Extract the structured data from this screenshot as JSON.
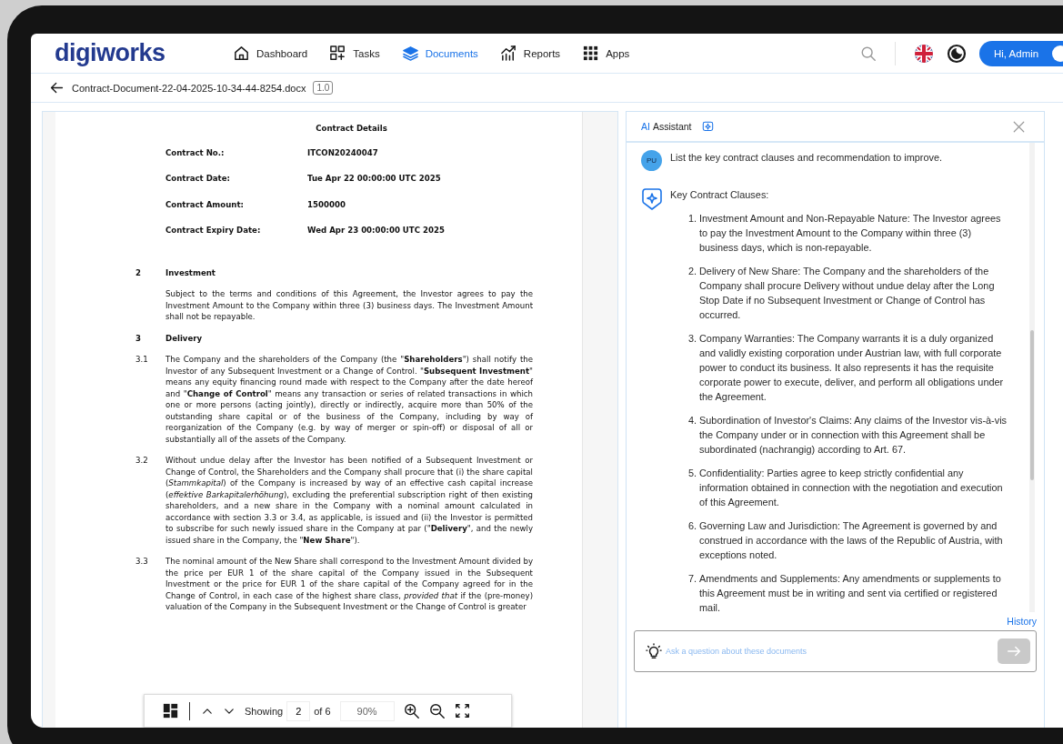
{
  "nav": {
    "logo": "digiworks",
    "items": [
      {
        "label": "Dashboard",
        "selected": false
      },
      {
        "label": "Tasks",
        "selected": false
      },
      {
        "label": "Documents",
        "selected": true
      },
      {
        "label": "Reports",
        "selected": false
      },
      {
        "label": "Apps",
        "selected": false
      }
    ],
    "user_button": "Hi, Admin"
  },
  "document_header": {
    "filename": "Contract-Document-22-04-2025-10-34-44-8254.docx",
    "version": "1.0"
  },
  "document": {
    "title": "Contract Details",
    "details": [
      {
        "label": "Contract No.:",
        "value": "ITCON20240047"
      },
      {
        "label": "Contract Date:",
        "value": "Tue Apr 22 00:00:00 UTC 2025"
      },
      {
        "label": "Contract Amount:",
        "value": "1500000"
      },
      {
        "label": "Contract Expiry Date:",
        "value": "Wed Apr 23 00:00:00 UTC 2025"
      }
    ],
    "blocks": [
      {
        "kind": "heading",
        "number": "2",
        "text": "Investment"
      },
      {
        "kind": "paragraph",
        "text": "Subject to the terms and conditions of this Agreement, the Investor agrees to pay the Investment Amount to the Company within three (3) business days. The Investment Amount shall not be repayable."
      },
      {
        "kind": "heading",
        "number": "3",
        "text": "Delivery"
      },
      {
        "kind": "paragraph",
        "number": "3.1",
        "text": "The Company and the shareholders of the Company (the \"**Shareholders**\") shall notify the Investor of any Subsequent Investment or a Change of Control. \"**Subsequent Investment**\" means any equity financing round made with respect to the Company after the date hereof and \"**Change of Control**\" means any transaction or series of related transactions in which one or more persons (acting jointly), directly or indirectly, acquire more than 50% of the outstanding share capital or of the business of the Company, including by way of reorganization of the Company (e.g. by way of merger or spin-off) or disposal of all or substantially all of the assets of the Company."
      },
      {
        "kind": "paragraph",
        "number": "3.2",
        "text": "Without undue delay after the Investor has been notified of a Subsequent Investment or Change of Control, the Shareholders and the Company shall procure that (i) the share capital (*Stammkapital*) of the Company is increased by way of an effective cash capital increase (*effektive Barkapitalerhöhung*), excluding the preferential subscription right of then existing shareholders, and a new share in the Company with a nominal amount calculated in accordance with section 3.3 or 3.4, as applicable, is issued and (ii) the Investor is permitted to subscribe for such newly issued share in the Company at par (\"**Delivery**\", and the newly issued share in the Company, the \"**New Share**\")."
      },
      {
        "kind": "paragraph",
        "number": "3.3",
        "text": "The nominal amount of the New Share shall correspond to the Investment Amount divided by the price per EUR 1 of the share capital of the Company issued in the Subsequent Investment or the price for EUR 1 of the share capital of the Company agreed for in the Change of Control, in each case of the highest share class, *provided that* if the (pre-money) valuation of the Company in the Subsequent Investment or the Change of Control is greater"
      }
    ]
  },
  "viewer_toolbar": {
    "showing_label": "Showing",
    "page": "2",
    "page_total": "of 6",
    "zoom": "90%"
  },
  "assistant": {
    "badge": "AI",
    "title": "Assistant",
    "question": {
      "avatar": "PU",
      "text": "List the key contract clauses and recommendation to improve."
    },
    "answer": {
      "heading": "Key Contract Clauses:",
      "items": [
        {
          "number": "1.",
          "text": "Investment Amount and Non-Repayable Nature: The Investor agrees to pay the Investment Amount to the Company within three (3) business days, which is non-repayable."
        },
        {
          "number": "2.",
          "text": "Delivery of New Share: The Company and the shareholders of the Company shall procure Delivery without undue delay after the Long Stop Date if no Subsequent Investment or Change of Control has occurred."
        },
        {
          "number": "3.",
          "text": "Company Warranties: The Company warrants it is a duly organized and validly existing corporation under Austrian law, with full corporate power to conduct its business. It also represents it has the requisite corporate power to execute, deliver, and perform all obligations under the Agreement."
        },
        {
          "number": "4.",
          "text": "Subordination of Investor's Claims: Any claims of the Investor vis-à-vis the Company under or in connection with this Agreement shall be subordinated (nachrangig) according to Art. 67."
        },
        {
          "number": "5.",
          "text": "Confidentiality: Parties agree to keep strictly confidential any information obtained in connection with the negotiation and execution of this Agreement."
        },
        {
          "number": "6.",
          "text": "Governing Law and Jurisdiction: The Agreement is governed by and construed in accordance with the laws of the Republic of Austria, with exceptions noted."
        },
        {
          "number": "7.",
          "text": "Amendments and Supplements: Any amendments or supplements to this Agreement must be in writing and sent via certified or registered mail."
        }
      ]
    },
    "history_link": "History",
    "input": {
      "placeholder": "Ask a question about these documents"
    }
  }
}
